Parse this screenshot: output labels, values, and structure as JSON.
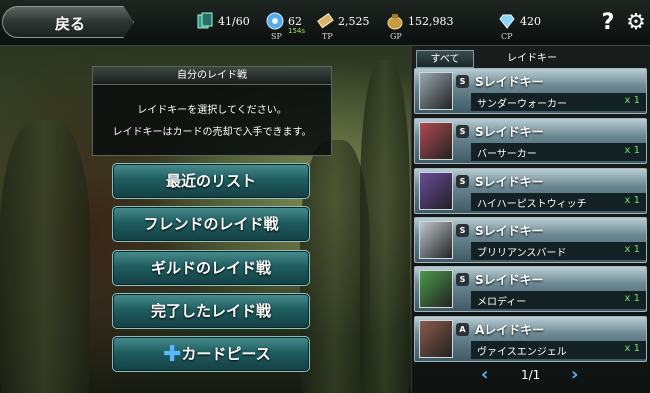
{
  "topbar": {
    "back_label": "戻る",
    "stats": [
      {
        "name": "cards",
        "value": "41/60",
        "label": "",
        "icon": "cards-icon"
      },
      {
        "name": "sp",
        "value": "62",
        "sub": "154s",
        "label": "SP",
        "icon": "sp-orb-icon"
      },
      {
        "name": "tp",
        "value": "2,525",
        "label": "TP",
        "icon": "scroll-icon"
      },
      {
        "name": "gp",
        "value": "152,983",
        "label": "GP",
        "icon": "money-bag-icon"
      },
      {
        "name": "cp",
        "value": "420",
        "label": "CP",
        "icon": "diamond-icon"
      }
    ]
  },
  "info": {
    "title": "自分のレイド戦",
    "line1": "レイドキーを選択してください。",
    "line2": "レイドキーはカードの売却で入手できます。"
  },
  "menu": [
    {
      "id": "recent",
      "label": "最近のリスト"
    },
    {
      "id": "friend",
      "label": "フレンドのレイド戦"
    },
    {
      "id": "guild",
      "label": "ギルドのレイド戦"
    },
    {
      "id": "finished",
      "label": "完了したレイド戦"
    },
    {
      "id": "pieces",
      "label": "カードピース"
    }
  ],
  "tabs": {
    "all": "すべて",
    "raid_key": "レイドキー"
  },
  "keys": [
    {
      "rank": "S",
      "name": "Sレイドキー",
      "card": "サンダーウォーカー",
      "qty": "x 1",
      "thumb_color": "#9aa8b0"
    },
    {
      "rank": "S",
      "name": "Sレイドキー",
      "card": "バーサーカー",
      "qty": "x 1",
      "thumb_color": "#b04a52"
    },
    {
      "rank": "S",
      "name": "Sレイドキー",
      "card": "ハイハーピストウィッチ",
      "qty": "x 1",
      "thumb_color": "#6a4a9a"
    },
    {
      "rank": "S",
      "name": "Sレイドキー",
      "card": "ブリリアンスバード",
      "qty": "x 1",
      "thumb_color": "#c0c8cc"
    },
    {
      "rank": "S",
      "name": "Sレイドキー",
      "card": "メロディー",
      "qty": "x 1",
      "thumb_color": "#4a9a4a"
    },
    {
      "rank": "A",
      "name": "Aレイドキー",
      "card": "ヴァイスエンジェル",
      "qty": "x 1",
      "thumb_color": "#8a5a4a"
    }
  ],
  "pager": {
    "page": "1/1"
  },
  "colors": {
    "accent": "#56b7ff",
    "qty": "#6ee066",
    "button": "#1f5d60"
  }
}
